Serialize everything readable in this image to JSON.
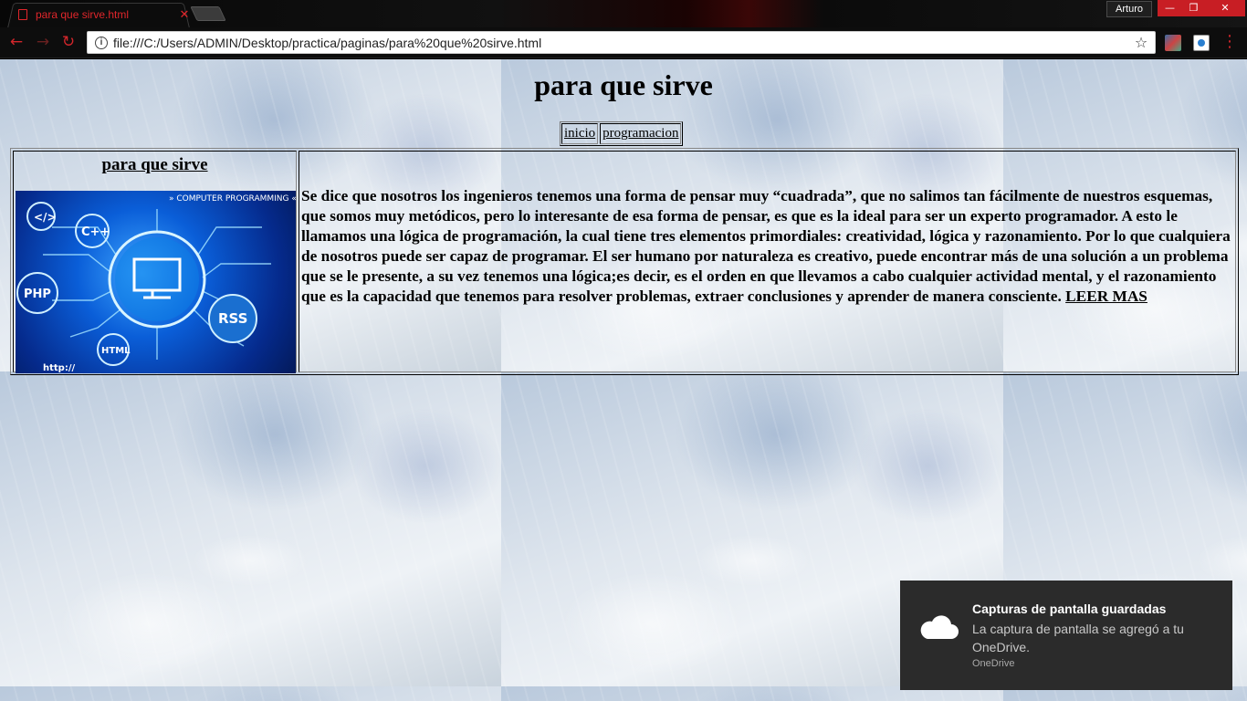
{
  "browser": {
    "tab_title": "para que sirve.html",
    "tab_close": "✕",
    "profile_name": "Arturo",
    "url": "file:///C:/Users/ADMIN/Desktop/practica/paginas/para%20que%20sirve.html",
    "window_controls": {
      "minimize": "—",
      "maximize": "❐",
      "close": "✕"
    },
    "nav": {
      "back": "←",
      "forward": "→",
      "reload": "↻",
      "menu": "⋮",
      "star": "☆",
      "info": "i"
    },
    "accent_color": "#d3262b"
  },
  "page": {
    "title": "para que sirve",
    "nav_links": [
      {
        "label": "inicio"
      },
      {
        "label": "programacion"
      }
    ],
    "sidebar": {
      "title": "para que sirve",
      "image_labels": {
        "banner": "» COMPUTER PROGRAMMING «",
        "tag_code": "</>",
        "tag_cpp": "C++",
        "tag_php": "PHP",
        "tag_rss": "RSS",
        "tag_html": "HTML",
        "tag_http": "http://"
      }
    },
    "body_text": "Se dice que nosotros los ingenieros tenemos una forma de pensar muy “cuadrada”, que no salimos tan fácilmente de nuestros esquemas, que somos muy metódicos, pero lo interesante de esa forma de pensar, es que es la ideal para ser un experto programador. A esto le llamamos una lógica de programación, la cual tiene tres elementos primordiales: creatividad, lógica y razonamiento. Por lo que cualquiera de nosotros puede ser capaz de programar. El ser humano por naturaleza es creativo, puede encontrar más de una solución a un problema que se le presente, a su vez tenemos una lógica;es decir, es el orden en que llevamos a cabo cualquier actividad mental, y el razonamiento que es la capacidad que tenemos para resolver problemas, extraer conclusiones y aprender de manera consciente.",
    "read_more": "LEER MAS"
  },
  "toast": {
    "title": "Capturas de pantalla guardadas",
    "body": "La captura de pantalla se agregó a tu OneDrive.",
    "app": "OneDrive"
  }
}
